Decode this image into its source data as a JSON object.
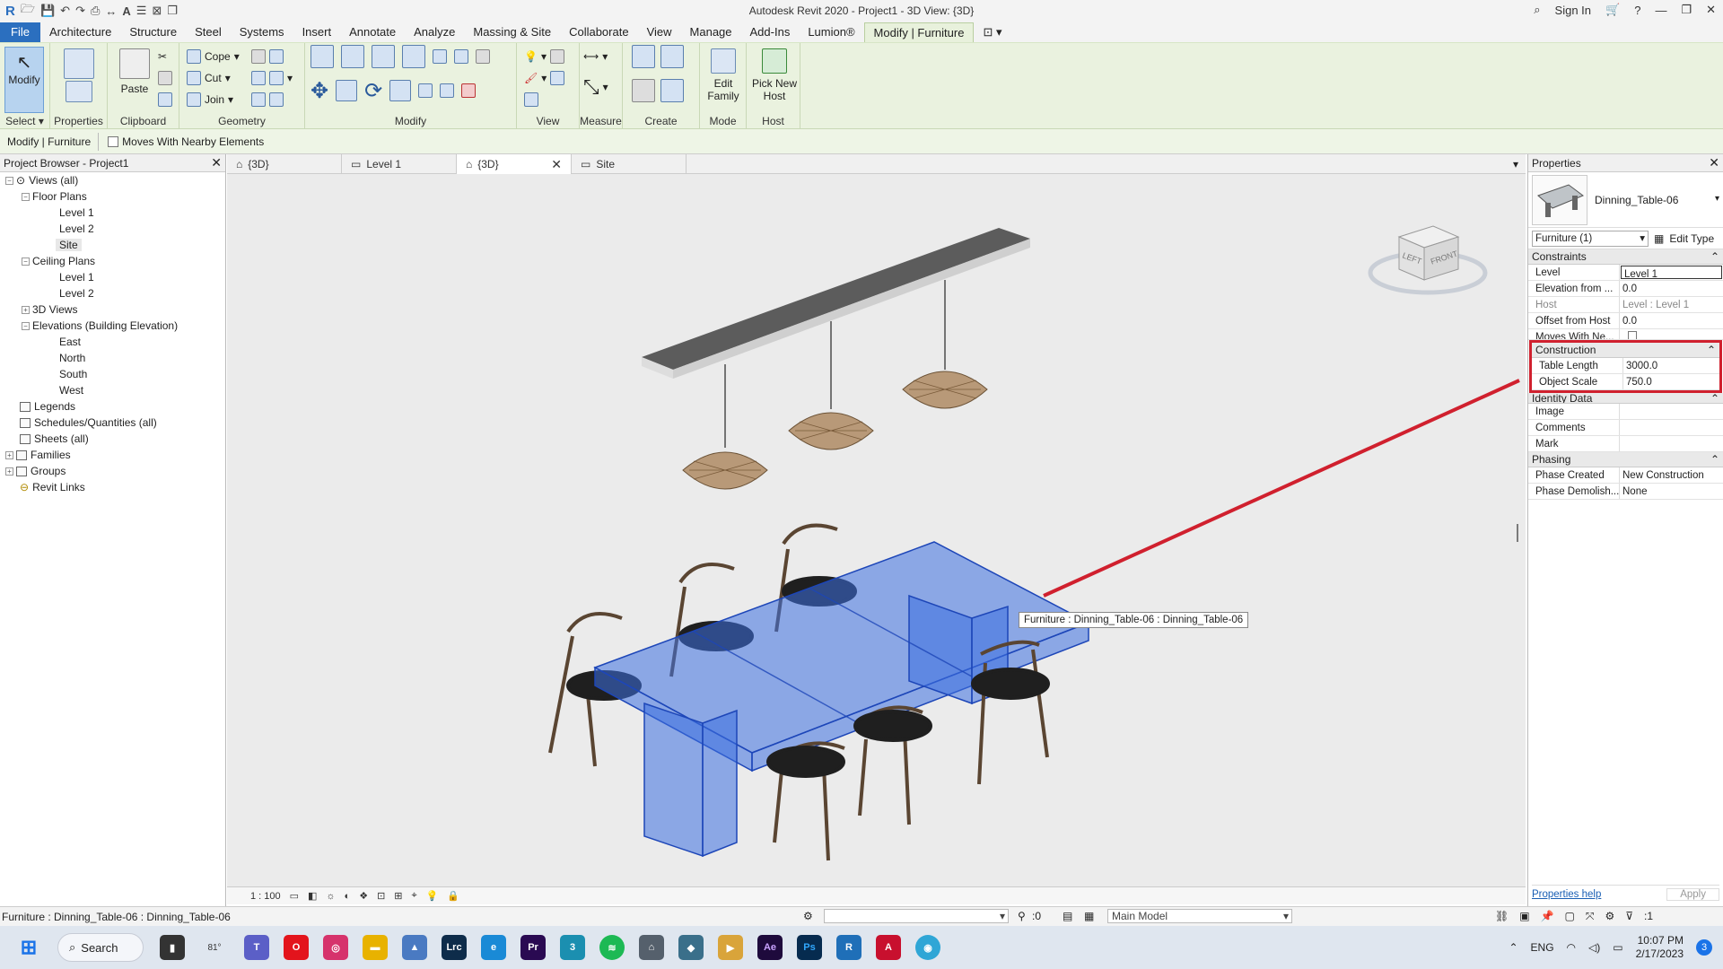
{
  "window": {
    "title": "Autodesk Revit 2020 - Project1 - 3D View: {3D}",
    "sign_in": "Sign In"
  },
  "ribbon_tabs": [
    "File",
    "Architecture",
    "Structure",
    "Steel",
    "Systems",
    "Insert",
    "Annotate",
    "Analyze",
    "Massing & Site",
    "Collaborate",
    "View",
    "Manage",
    "Add-Ins",
    "Lumion®",
    "Modify | Furniture"
  ],
  "ribbon": {
    "select": {
      "modify": "Modify",
      "label": "Select ▾"
    },
    "properties": {
      "label": "Properties"
    },
    "clipboard": {
      "paste": "Paste",
      "label": "Clipboard"
    },
    "geometry": {
      "cope": "Cope",
      "cut": "Cut",
      "join": "Join",
      "label": "Geometry"
    },
    "modify": {
      "label": "Modify"
    },
    "view": {
      "label": "View"
    },
    "measure": {
      "label": "Measure"
    },
    "create": {
      "label": "Create"
    },
    "mode": {
      "edit_family": "Edit Family",
      "label": "Mode"
    },
    "host": {
      "pick_new_host": "Pick New Host",
      "label": "Host"
    }
  },
  "options_bar": {
    "context": "Modify | Furniture",
    "moves_with": "Moves With Nearby Elements"
  },
  "project_browser": {
    "title": "Project Browser - Project1",
    "items": [
      {
        "label": "Views (all)"
      },
      {
        "label": "Floor Plans"
      },
      {
        "label": "Level 1"
      },
      {
        "label": "Level 2"
      },
      {
        "label": "Site"
      },
      {
        "label": "Ceiling Plans"
      },
      {
        "label": "Level 1"
      },
      {
        "label": "Level 2"
      },
      {
        "label": "3D Views"
      },
      {
        "label": "Elevations (Building Elevation)"
      },
      {
        "label": "East"
      },
      {
        "label": "North"
      },
      {
        "label": "South"
      },
      {
        "label": "West"
      },
      {
        "label": "Legends"
      },
      {
        "label": "Schedules/Quantities (all)"
      },
      {
        "label": "Sheets (all)"
      },
      {
        "label": "Families"
      },
      {
        "label": "Groups"
      },
      {
        "label": "Revit Links"
      }
    ]
  },
  "view_tabs": [
    {
      "label": "{3D}"
    },
    {
      "label": "Level 1"
    },
    {
      "label": "{3D}"
    },
    {
      "label": "Site"
    }
  ],
  "viewport": {
    "tooltip": "Furniture : Dinning_Table-06 : Dinning_Table-06",
    "scale": "1 : 100",
    "viewcube_left": "LEFT",
    "viewcube_front": "FRONT"
  },
  "properties": {
    "title": "Properties",
    "type_name": "Dinning_Table-06",
    "selector": "Furniture (1)",
    "edit_type": "Edit Type",
    "groups": {
      "constraints": "Constraints",
      "construction": "Construction",
      "identity": "Identity Data",
      "phasing": "Phasing"
    },
    "constraints": [
      {
        "k": "Level",
        "v": "Level 1"
      },
      {
        "k": "Elevation from ...",
        "v": "0.0"
      },
      {
        "k": "Host",
        "v": "Level : Level 1"
      },
      {
        "k": "Offset from Host",
        "v": "0.0"
      },
      {
        "k": "Moves With Ne...",
        "v": ""
      }
    ],
    "construction": [
      {
        "k": "Table Length",
        "v": "3000.0"
      },
      {
        "k": "Object Scale",
        "v": "750.0"
      }
    ],
    "identity": [
      {
        "k": "Image",
        "v": ""
      },
      {
        "k": "Comments",
        "v": ""
      },
      {
        "k": "Mark",
        "v": ""
      }
    ],
    "phasing": [
      {
        "k": "Phase Created",
        "v": "New Construction"
      },
      {
        "k": "Phase Demolish...",
        "v": "None"
      }
    ],
    "help": "Properties help",
    "apply": "Apply"
  },
  "status": {
    "text": "Furniture : Dinning_Table-06 : Dinning_Table-06",
    "zero": ":0",
    "model": "Main Model",
    "filter": ":1"
  },
  "taskbar": {
    "weather": "81°",
    "search": "Search",
    "lang": "ENG",
    "time": "10:07 PM",
    "date": "2/17/2023",
    "badge": "3"
  },
  "colors": {
    "ribbon_bg": "#eaf2df",
    "selection_blue": "#3c6fe0",
    "annotation_red": "#d0202e",
    "file_tab": "#2b6fbf"
  }
}
